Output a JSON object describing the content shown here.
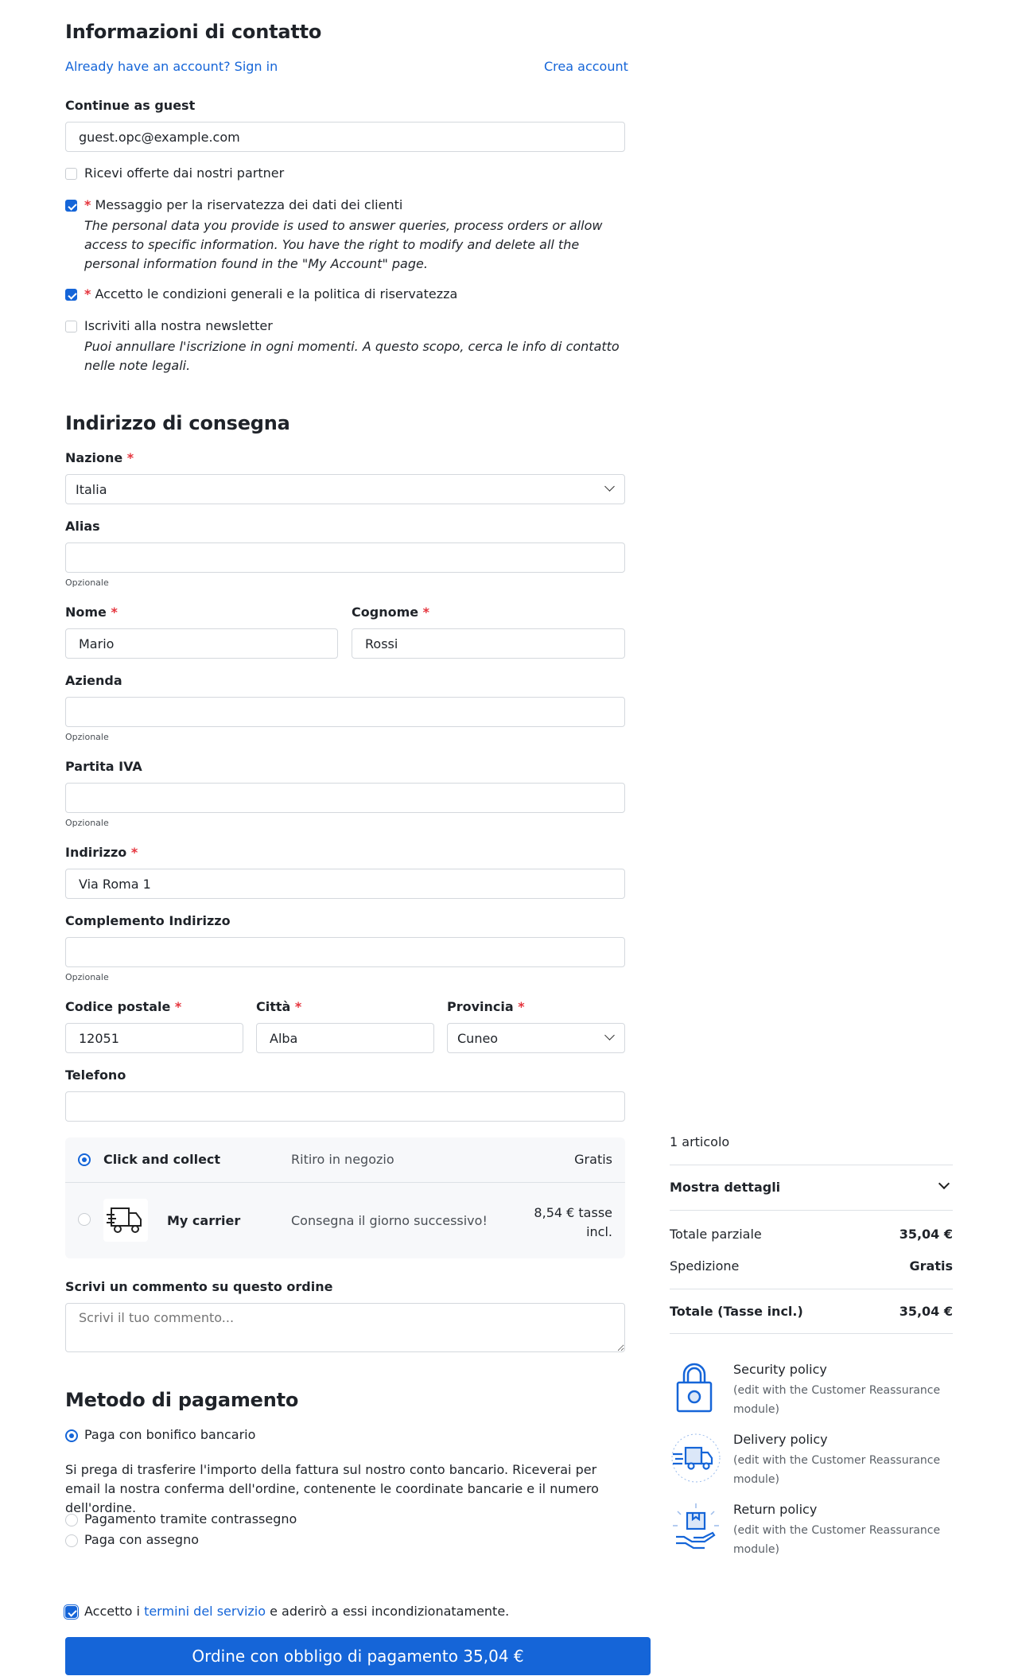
{
  "contact": {
    "title": "Informazioni di contatto",
    "signin_link": "Already have an account? Sign in",
    "create_account_link": "Crea account",
    "guest_label": "Continue as guest",
    "email_value": "guest.opc@example.com",
    "partners_offers": "Ricevi offerte dai nostri partner",
    "privacy_label": "Messaggio per la riservatezza dei dati dei clienti",
    "privacy_text": "The personal data you provide is used to answer queries, process orders or allow access to specific information. You have the right to modify and delete all the personal information found in the \"My Account\" page.",
    "terms_privacy": "Accetto le condizioni generali e la politica di riservatezza",
    "newsletter_label": "Iscriviti alla nostra newsletter",
    "newsletter_text": "Puoi annullare l'iscrizione in ogni momenti. A questo scopo, cerca le info di contatto nelle note legali.",
    "required_mark": "*"
  },
  "address": {
    "title": "Indirizzo di consegna",
    "optional": "Opzionale",
    "country_label": "Nazione",
    "country_value": "Italia",
    "alias_label": "Alias",
    "firstname_label": "Nome",
    "firstname_value": "Mario",
    "lastname_label": "Cognome",
    "lastname_value": "Rossi",
    "company_label": "Azienda",
    "vat_label": "Partita IVA",
    "address_label": "Indirizzo",
    "address_value": "Via Roma 1",
    "address2_label": "Complemento Indirizzo",
    "postcode_label": "Codice postale",
    "postcode_value": "12051",
    "city_label": "Città",
    "city_value": "Alba",
    "province_label": "Provincia",
    "province_value": "Cuneo",
    "phone_label": "Telefono"
  },
  "shipping": {
    "options": [
      {
        "name": "Click and collect",
        "desc": "Ritiro in negozio",
        "price": "Gratis"
      },
      {
        "name": "My carrier",
        "desc": "Consegna il giorno successivo!",
        "price_line1": "8,54 € tasse",
        "price_line2": "incl."
      }
    ],
    "comment_label": "Scrivi un commento su questo ordine",
    "comment_placeholder": "Scrivi il tuo commento..."
  },
  "payment": {
    "title": "Metodo di pagamento",
    "bank_wire": "Paga con bonifico bancario",
    "bank_wire_text": "Si prega di trasferire l'importo della fattura sul nostro conto bancario. Riceverai per email la nostra conferma dell'ordine, contenente le coordinate bancarie e il numero dell'ordine.",
    "cod": "Pagamento tramite contrassegno",
    "cheque": "Paga con assegno",
    "terms_prefix": "Accetto i",
    "terms_link": "termini del servizio",
    "terms_suffix": "e aderirò a essi incondizionatamente.",
    "submit_label": "Ordine con obbligo di pagamento 35,04 €"
  },
  "summary": {
    "items_count": "1 articolo",
    "show_details": "Mostra dettagli",
    "subtotal_label": "Totale parziale",
    "subtotal_value": "35,04 €",
    "shipping_label": "Spedizione",
    "shipping_value": "Gratis",
    "total_label": "Totale (Tasse incl.)",
    "total_value": "35,04 €"
  },
  "reassurance": [
    {
      "title": "Security policy",
      "line1": "(edit with the Customer Reassurance",
      "line2": "module)",
      "icon": "lock-icon"
    },
    {
      "title": "Delivery policy",
      "line1": "(edit with the Customer Reassurance",
      "line2": "module)",
      "icon": "delivery-truck-icon"
    },
    {
      "title": "Return policy",
      "line1": "(edit with the Customer Reassurance",
      "line2": "module)",
      "icon": "return-box-icon"
    }
  ],
  "colors": {
    "accent": "#1565d8",
    "required": "#e5343d",
    "border": "#d4d8dd"
  }
}
